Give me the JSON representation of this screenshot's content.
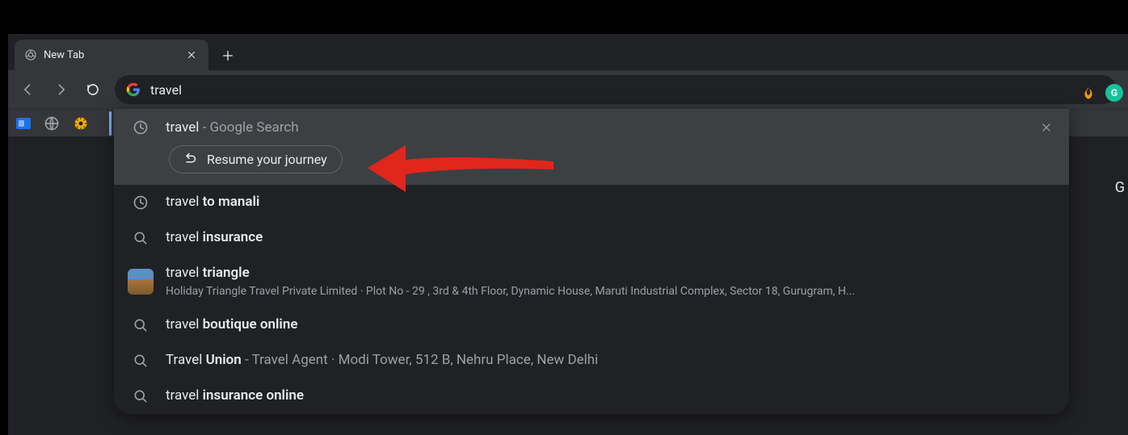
{
  "tab": {
    "title": "New Tab"
  },
  "omnibox": {
    "value": "travel "
  },
  "suggestions": [
    {
      "icon": "clock",
      "prefix": "travel",
      "bold": "",
      "suffix_dim": " - Google Search",
      "highlighted": true,
      "has_chip": true,
      "has_remove": true
    },
    {
      "icon": "clock",
      "prefix": "travel ",
      "bold": "to manali"
    },
    {
      "icon": "search",
      "prefix": "travel ",
      "bold": "insurance"
    },
    {
      "icon": "thumb",
      "prefix": "travel ",
      "bold": "triangle",
      "sub": "Holiday Triangle Travel Private Limited · Plot No - 29 , 3rd & 4th Floor, Dynamic House, Maruti Industrial Complex, Sector 18, Gurugram, H..."
    },
    {
      "icon": "search",
      "prefix": "travel ",
      "bold": "boutique online"
    },
    {
      "icon": "search",
      "prefix": "Travel ",
      "bold": "Union",
      "suffix_dim": " -  Travel Agent · Modi Tower, 512 B, Nehru Place, New Delhi"
    },
    {
      "icon": "search",
      "prefix": "travel ",
      "bold": "insurance online"
    }
  ],
  "chip": {
    "label": "Resume your journey"
  },
  "ext": {
    "g_label": "G"
  },
  "side_letter": "G"
}
